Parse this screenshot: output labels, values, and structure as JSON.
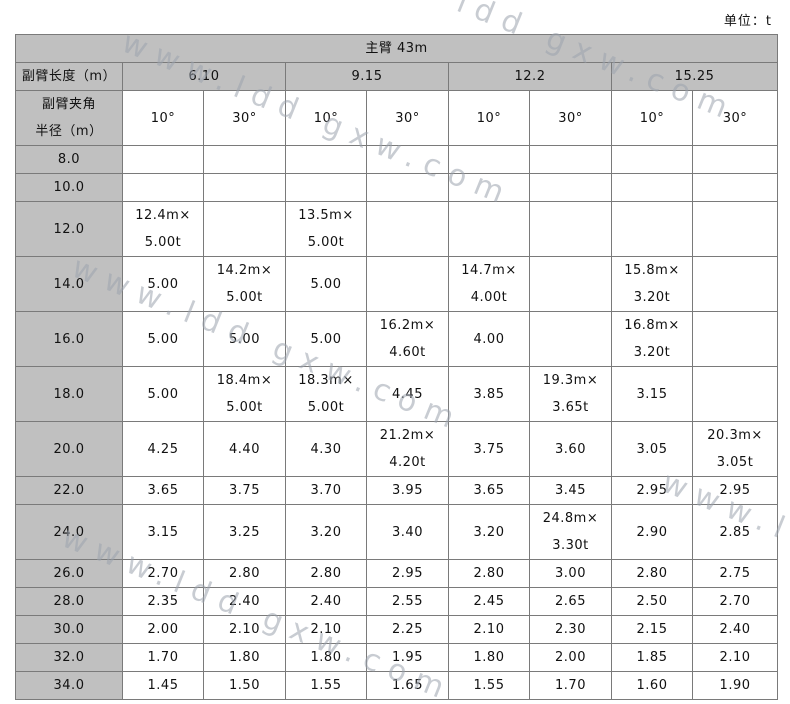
{
  "unit_label": "单位：t",
  "main_header": "主臂 43m",
  "jib_length_label": "副臂长度（m）",
  "jib_lengths": [
    "6.10",
    "9.15",
    "12.2",
    "15.25"
  ],
  "angle_label_line1": "副臂夹角",
  "angle_label_line2": "半径（m）",
  "angles": [
    "10°",
    "30°",
    "10°",
    "30°",
    "10°",
    "30°",
    "10°",
    "30°"
  ],
  "rows": [
    {
      "radius": "8.0",
      "cells": [
        [],
        [],
        [],
        [],
        [],
        [],
        [],
        []
      ]
    },
    {
      "radius": "10.0",
      "cells": [
        [],
        [],
        [],
        [],
        [],
        [],
        [],
        []
      ]
    },
    {
      "radius": "12.0",
      "cells": [
        [
          "12.4m×",
          "5.00t"
        ],
        [],
        [
          "13.5m×",
          "5.00t"
        ],
        [],
        [],
        [],
        [],
        []
      ]
    },
    {
      "radius": "14.0",
      "cells": [
        [
          "5.00"
        ],
        [
          "14.2m×",
          "5.00t"
        ],
        [
          "5.00"
        ],
        [],
        [
          "14.7m×",
          "4.00t"
        ],
        [],
        [
          "15.8m×",
          "3.20t"
        ],
        []
      ]
    },
    {
      "radius": "16.0",
      "cells": [
        [
          "5.00"
        ],
        [
          "5.00"
        ],
        [
          "5.00"
        ],
        [
          "16.2m×",
          "4.60t"
        ],
        [
          "4.00"
        ],
        [],
        [
          "16.8m×",
          "3.20t"
        ],
        []
      ]
    },
    {
      "radius": "18.0",
      "cells": [
        [
          "5.00"
        ],
        [
          "18.4m×",
          "5.00t"
        ],
        [
          "18.3m×",
          "5.00t"
        ],
        [
          "4.45"
        ],
        [
          "3.85"
        ],
        [
          "19.3m×",
          "3.65t"
        ],
        [
          "3.15"
        ],
        []
      ]
    },
    {
      "radius": "20.0",
      "cells": [
        [
          "4.25"
        ],
        [
          "4.40"
        ],
        [
          "4.30"
        ],
        [
          "21.2m×",
          "4.20t"
        ],
        [
          "3.75"
        ],
        [
          "3.60"
        ],
        [
          "3.05"
        ],
        [
          "20.3m×",
          "3.05t"
        ]
      ]
    },
    {
      "radius": "22.0",
      "cells": [
        [
          "3.65"
        ],
        [
          "3.75"
        ],
        [
          "3.70"
        ],
        [
          "3.95"
        ],
        [
          "3.65"
        ],
        [
          "3.45"
        ],
        [
          "2.95"
        ],
        [
          "2.95"
        ]
      ]
    },
    {
      "radius": "24.0",
      "cells": [
        [
          "3.15"
        ],
        [
          "3.25"
        ],
        [
          "3.20"
        ],
        [
          "3.40"
        ],
        [
          "3.20"
        ],
        [
          "24.8m×",
          "3.30t"
        ],
        [
          "2.90"
        ],
        [
          "2.85"
        ]
      ]
    },
    {
      "radius": "26.0",
      "cells": [
        [
          "2.70"
        ],
        [
          "2.80"
        ],
        [
          "2.80"
        ],
        [
          "2.95"
        ],
        [
          "2.80"
        ],
        [
          "3.00"
        ],
        [
          "2.80"
        ],
        [
          "2.75"
        ]
      ]
    },
    {
      "radius": "28.0",
      "cells": [
        [
          "2.35"
        ],
        [
          "2.40"
        ],
        [
          "2.40"
        ],
        [
          "2.55"
        ],
        [
          "2.45"
        ],
        [
          "2.65"
        ],
        [
          "2.50"
        ],
        [
          "2.70"
        ]
      ]
    },
    {
      "radius": "30.0",
      "cells": [
        [
          "2.00"
        ],
        [
          "2.10"
        ],
        [
          "2.10"
        ],
        [
          "2.25"
        ],
        [
          "2.10"
        ],
        [
          "2.30"
        ],
        [
          "2.15"
        ],
        [
          "2.40"
        ]
      ]
    },
    {
      "radius": "32.0",
      "cells": [
        [
          "1.70"
        ],
        [
          "1.80"
        ],
        [
          "1.80"
        ],
        [
          "1.95"
        ],
        [
          "1.80"
        ],
        [
          "2.00"
        ],
        [
          "1.85"
        ],
        [
          "2.10"
        ]
      ]
    },
    {
      "radius": "34.0",
      "cells": [
        [
          "1.45"
        ],
        [
          "1.50"
        ],
        [
          "1.55"
        ],
        [
          "1.65"
        ],
        [
          "1.55"
        ],
        [
          "1.70"
        ],
        [
          "1.60"
        ],
        [
          "1.90"
        ]
      ]
    }
  ],
  "watermark": [
    "ldd gxw.com",
    "www.ldd gxw.com",
    "www.ldd gxw.com",
    "www.ldd gxw.com",
    "www.ld"
  ]
}
